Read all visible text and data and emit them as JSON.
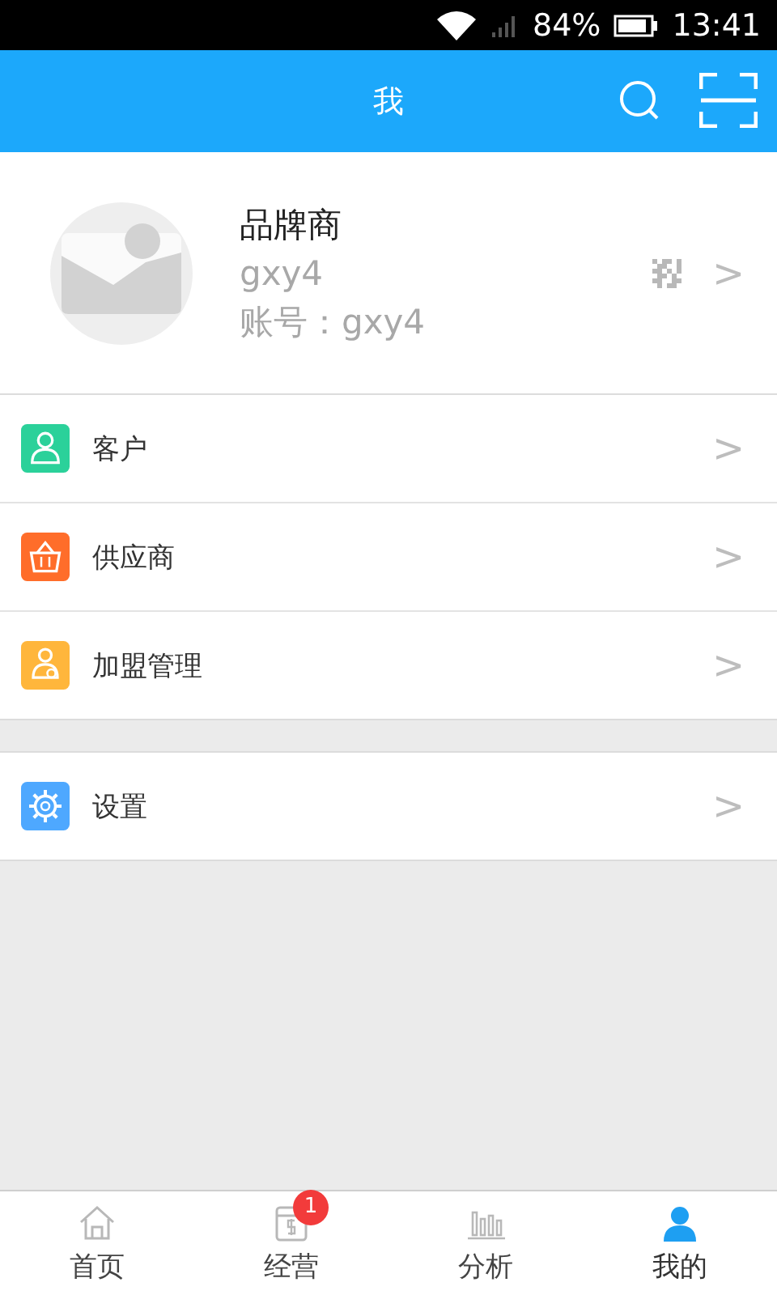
{
  "status_bar": {
    "battery_text": "84%",
    "time": "13:41"
  },
  "header": {
    "title": "我"
  },
  "profile": {
    "name": "品牌商",
    "username": "gxy4",
    "account": "账号：gxy4",
    "chevron": ">"
  },
  "menu_groups": [
    {
      "items": [
        {
          "label": "客户",
          "kind": "person",
          "color": "#2bd19a",
          "chevron": ">"
        },
        {
          "label": "供应商",
          "kind": "basket",
          "color": "#ff6d2a",
          "chevron": ">"
        },
        {
          "label": "加盟管理",
          "kind": "member",
          "color": "#ffb63c",
          "chevron": ">"
        }
      ]
    },
    {
      "items": [
        {
          "label": "设置",
          "kind": "gear",
          "color": "#4ea8ff",
          "chevron": ">"
        }
      ]
    }
  ],
  "tabs": [
    {
      "label": "首页",
      "kind": "home",
      "selected": false
    },
    {
      "label": "经营",
      "kind": "ledger",
      "selected": false,
      "badge": "1"
    },
    {
      "label": "分析",
      "kind": "bars",
      "selected": false
    },
    {
      "label": "我的",
      "kind": "user",
      "selected": true
    }
  ]
}
